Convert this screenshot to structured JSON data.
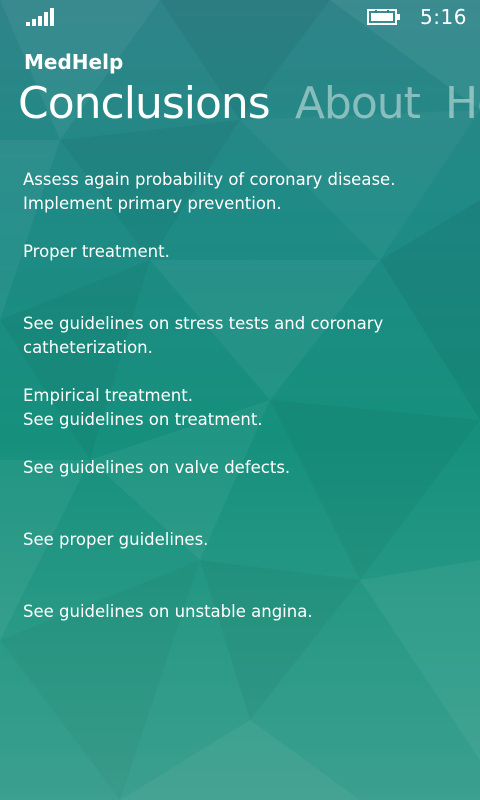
{
  "status_bar": {
    "signal_icon": "signal-strength-icon",
    "battery_icon": "battery-charging-icon",
    "time": "5:16"
  },
  "app": {
    "title": "MedHelp"
  },
  "pivot": {
    "tabs": [
      {
        "label": "Conclusions",
        "active": true
      },
      {
        "label": "About",
        "active": false
      },
      {
        "label": "Home",
        "active": false
      }
    ]
  },
  "conclusions": [
    {
      "lines": [
        "Assess again probability of coronary disease.",
        "Implement primary prevention."
      ]
    },
    {
      "lines": [
        "Proper treatment."
      ]
    },
    {
      "lines": [
        "See guidelines on stress tests and coronary",
        "catheterization."
      ]
    },
    {
      "lines": [
        "Empirical treatment.",
        "See guidelines on treatment."
      ]
    },
    {
      "lines": [
        "See guidelines on valve defects."
      ]
    },
    {
      "lines": [
        "See proper guidelines."
      ]
    },
    {
      "lines": [
        "See guidelines on unstable angina."
      ]
    }
  ],
  "colors": {
    "background_top": "#2f8488",
    "background_mid": "#16907d",
    "background_bottom": "#3c9f8f",
    "text": "#ffffff",
    "inactive_tab": "rgba(255,255,255,0.45)"
  }
}
